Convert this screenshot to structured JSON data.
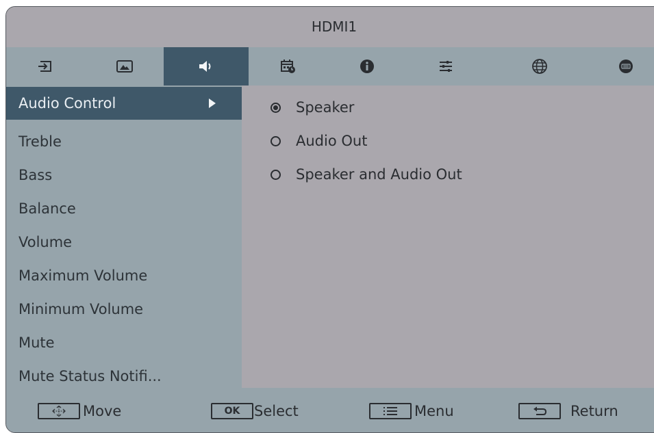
{
  "header": {
    "title": "HDMI1"
  },
  "tabs": [
    {
      "icon": "input-source-icon",
      "active": false
    },
    {
      "icon": "picture-icon",
      "active": false
    },
    {
      "icon": "audio-speaker-icon",
      "active": true
    },
    {
      "icon": "schedule-icon",
      "active": false
    },
    {
      "icon": "info-icon",
      "active": false
    },
    {
      "icon": "settings-sliders-icon",
      "active": false
    },
    {
      "icon": "globe-network-icon",
      "active": false
    },
    {
      "icon": "keyboard-icon",
      "active": false
    }
  ],
  "sidebar": {
    "items": [
      {
        "label": "Audio Control",
        "selected": true
      },
      {
        "label": "Treble"
      },
      {
        "label": "Bass"
      },
      {
        "label": "Balance"
      },
      {
        "label": "Volume"
      },
      {
        "label": "Maximum Volume"
      },
      {
        "label": "Minimum Volume"
      },
      {
        "label": "Mute"
      },
      {
        "label": "Mute Status Notifi..."
      }
    ]
  },
  "options": [
    {
      "label": "Speaker",
      "checked": true
    },
    {
      "label": "Audio Out",
      "checked": false
    },
    {
      "label": "Speaker and Audio Out",
      "checked": false
    }
  ],
  "footer": {
    "hints": [
      {
        "key_icon": "move-arrows-icon",
        "label": "Move"
      },
      {
        "key": "OK",
        "label": "Select"
      },
      {
        "key_icon": "menu-list-icon",
        "label": "Menu"
      },
      {
        "key_icon": "return-arrow-icon",
        "label": "Return"
      }
    ]
  },
  "colors": {
    "tab_bar": "#96a4ab",
    "active_highlight": "#3f5869",
    "content_bg": "#aaa7ad"
  }
}
